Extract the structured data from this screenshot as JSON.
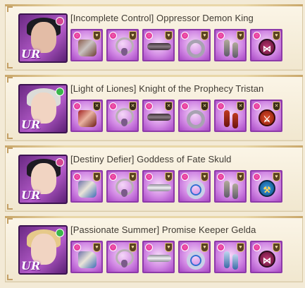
{
  "colors": {
    "background": "#f3ead6",
    "title_text": "#3f3a33",
    "slot_purple": "#a847c5",
    "rarity_badge": "#9b3cc0"
  },
  "characters": [
    {
      "title": "[Incomplete Control] Oppressor Demon King",
      "rarity": "UR",
      "slots": [
        {
          "icon": "gauntlet-icon",
          "kind": "gauntlet",
          "variant": "",
          "lock": "locked-icon"
        },
        {
          "icon": "necklace-icon",
          "kind": "necklace",
          "variant": "",
          "lock": "locked-icon"
        },
        {
          "icon": "belt-icon",
          "kind": "belt",
          "variant": "",
          "lock": "locked-icon"
        },
        {
          "icon": "ring-icon",
          "kind": "ring",
          "variant": "",
          "lock": "locked-icon"
        },
        {
          "icon": "earring-icon",
          "kind": "earring",
          "variant": "",
          "lock": "locked-icon"
        },
        {
          "icon": "rune-icon",
          "kind": "rune",
          "variant": "dark",
          "lock": "locked-icon",
          "glyph": "⋈"
        }
      ]
    },
    {
      "title": "[Light of Liones] Knight of the Prophecy Tristan",
      "rarity": "UR",
      "slots": [
        {
          "icon": "gauntlet-icon",
          "kind": "gauntlet",
          "variant": "red",
          "lock": "unlocked-icon"
        },
        {
          "icon": "necklace-icon",
          "kind": "necklace",
          "variant": "",
          "lock": "unlocked-icon"
        },
        {
          "icon": "belt-icon",
          "kind": "belt",
          "variant": "",
          "lock": "unlocked-icon"
        },
        {
          "icon": "ring-icon",
          "kind": "ring",
          "variant": "",
          "lock": "unlocked-icon"
        },
        {
          "icon": "earring-icon",
          "kind": "earring",
          "variant": "red",
          "lock": "unlocked-icon"
        },
        {
          "icon": "rune-icon",
          "kind": "rune",
          "variant": "red",
          "lock": "unlocked-icon",
          "glyph": "⚔"
        }
      ]
    },
    {
      "title": "[Destiny Defier] Goddess of Fate Skuld",
      "rarity": "UR",
      "slots": [
        {
          "icon": "gauntlet-icon",
          "kind": "gauntlet",
          "variant": "blue",
          "lock": "locked-icon"
        },
        {
          "icon": "necklace-icon",
          "kind": "necklace",
          "variant": "",
          "lock": "locked-icon"
        },
        {
          "icon": "belt-icon",
          "kind": "belt",
          "variant": "light",
          "lock": "locked-icon"
        },
        {
          "icon": "ring-icon",
          "kind": "ring",
          "variant": "blue",
          "lock": "locked-icon"
        },
        {
          "icon": "earring-icon",
          "kind": "earring",
          "variant": "",
          "lock": "locked-icon"
        },
        {
          "icon": "rune-icon",
          "kind": "rune",
          "variant": "blue",
          "lock": "locked-icon",
          "glyph": "⚒"
        }
      ]
    },
    {
      "title": "[Passionate Summer] Promise Keeper Gelda",
      "rarity": "UR",
      "slots": [
        {
          "icon": "gauntlet-icon",
          "kind": "gauntlet",
          "variant": "blue",
          "lock": "locked-icon"
        },
        {
          "icon": "necklace-icon",
          "kind": "necklace",
          "variant": "",
          "lock": "locked-icon"
        },
        {
          "icon": "belt-icon",
          "kind": "belt",
          "variant": "light",
          "lock": "locked-icon"
        },
        {
          "icon": "ring-icon",
          "kind": "ring",
          "variant": "blue",
          "lock": "locked-icon"
        },
        {
          "icon": "earring-icon",
          "kind": "earring",
          "variant": "blue",
          "lock": "locked-icon"
        },
        {
          "icon": "rune-icon",
          "kind": "rune",
          "variant": "dark",
          "lock": "locked-icon",
          "glyph": "⋈"
        }
      ]
    }
  ]
}
